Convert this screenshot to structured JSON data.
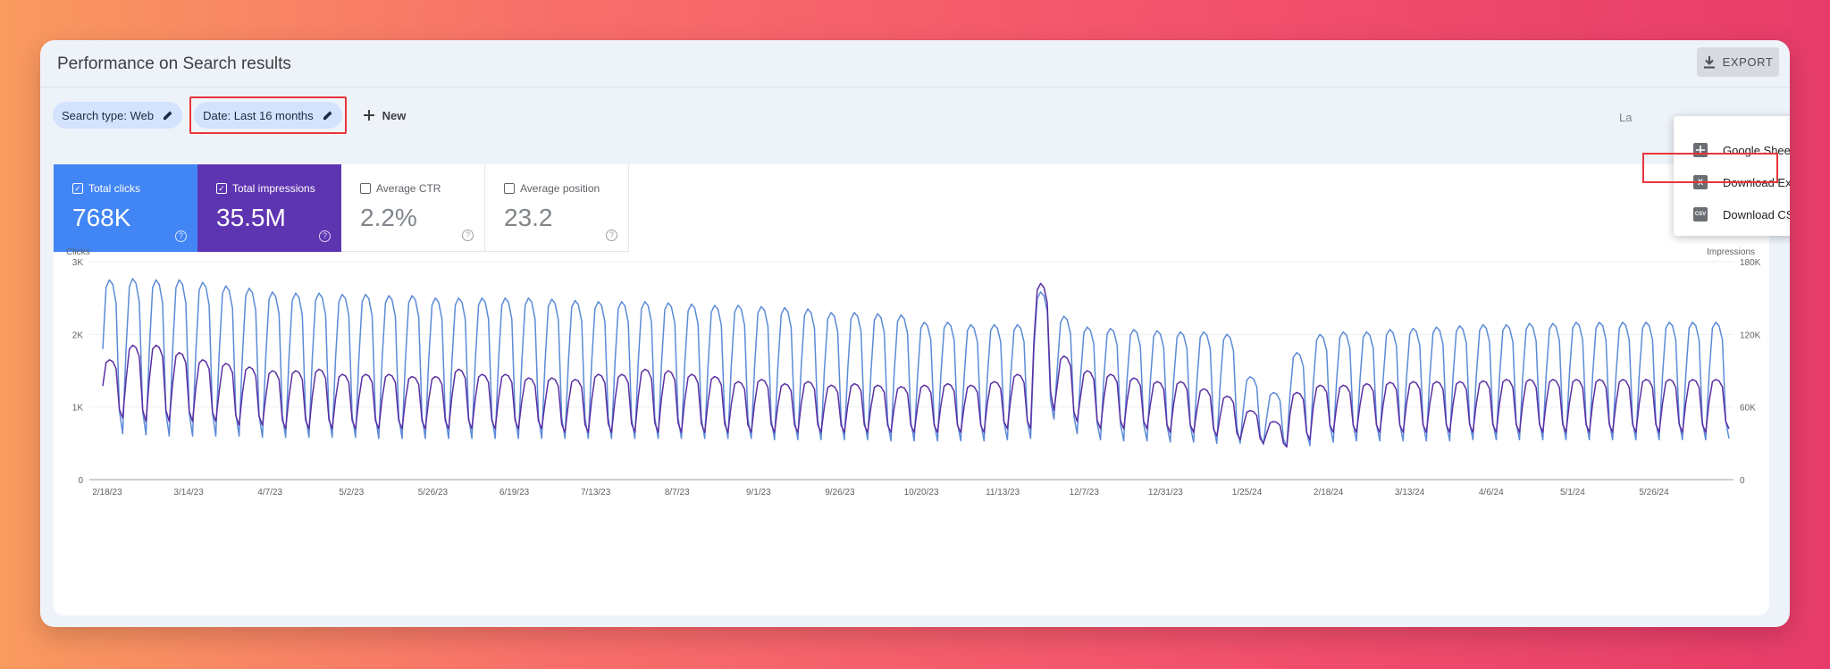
{
  "header": {
    "title": "Performance on Search results",
    "export_label": "EXPORT"
  },
  "filters": {
    "search_type": "Search type: Web",
    "date": "Date: Last 16 months",
    "new_label": "New",
    "partial_label": "La"
  },
  "export_menu": {
    "items": [
      {
        "label": "Google Sheets",
        "icon": "google-sheets-icon"
      },
      {
        "label": "Download Excel",
        "icon": "excel-icon",
        "glyph": "X"
      },
      {
        "label": "Download CSV",
        "icon": "csv-icon",
        "glyph": "CSV"
      }
    ]
  },
  "metrics": [
    {
      "label": "Total clicks",
      "value": "768K",
      "checked": true,
      "color": "#4285f4"
    },
    {
      "label": "Total impressions",
      "value": "35.5M",
      "checked": true,
      "color": "#5e35b1"
    },
    {
      "label": "Average CTR",
      "value": "2.2%",
      "checked": false
    },
    {
      "label": "Average position",
      "value": "23.2",
      "checked": false
    }
  ],
  "chart_data": {
    "type": "line",
    "left_axis": {
      "label": "Clicks",
      "ticks": [
        "0",
        "1K",
        "2K",
        "3K"
      ],
      "range": [
        0,
        3000
      ]
    },
    "right_axis": {
      "label": "Impressions",
      "ticks": [
        "0",
        "60K",
        "120K",
        "180K"
      ],
      "range": [
        0,
        180000
      ]
    },
    "x_tick_labels": [
      "2/18/23",
      "3/14/23",
      "4/7/23",
      "5/2/23",
      "5/26/23",
      "6/19/23",
      "7/13/23",
      "8/7/23",
      "9/1/23",
      "9/26/23",
      "10/20/23",
      "11/13/23",
      "12/7/23",
      "12/31/23",
      "1/25/24",
      "2/18/24",
      "3/13/24",
      "4/6/24",
      "5/1/24",
      "5/26/24"
    ],
    "series": [
      {
        "name": "Clicks",
        "axis": "left",
        "color": "#5a2fa3",
        "weekly_peak": [
          1650,
          1850,
          1850,
          1750,
          1650,
          1600,
          1550,
          1500,
          1500,
          1520,
          1450,
          1450,
          1450,
          1420,
          1420,
          1520,
          1450,
          1450,
          1400,
          1400,
          1380,
          1450,
          1450,
          1520,
          1500,
          1450,
          1420,
          1350,
          1380,
          1320,
          1350,
          1300,
          1320,
          1300,
          1280,
          1300,
          1320,
          1300,
          1350,
          1450,
          2700,
          1700,
          1500,
          1450,
          1400,
          1350,
          1350,
          1250,
          1150,
          950,
          800,
          1200,
          1300,
          1300,
          1320,
          1340,
          1350,
          1350,
          1350,
          1360,
          1380,
          1380,
          1380,
          1380,
          1380,
          1380,
          1380,
          1380,
          1380,
          1380
        ],
        "weekly_trough": [
          850,
          800,
          800,
          800,
          800,
          750,
          750,
          700,
          700,
          700,
          700,
          700,
          700,
          700,
          700,
          700,
          700,
          700,
          700,
          650,
          650,
          650,
          650,
          650,
          650,
          650,
          650,
          650,
          650,
          650,
          650,
          650,
          650,
          650,
          650,
          650,
          650,
          650,
          700,
          700,
          950,
          800,
          700,
          700,
          700,
          650,
          650,
          600,
          550,
          500,
          450,
          550,
          650,
          650,
          650,
          650,
          650,
          650,
          650,
          650,
          650,
          650,
          650,
          650,
          650,
          650,
          650,
          650,
          650,
          700
        ]
      },
      {
        "name": "Impressions",
        "axis": "right",
        "color": "#5b8bd6",
        "weekly_peak": [
          165000,
          166000,
          165000,
          165000,
          163000,
          160000,
          158000,
          155000,
          154000,
          154000,
          153000,
          153000,
          152000,
          152000,
          150000,
          150000,
          150000,
          150000,
          150000,
          149000,
          148000,
          147000,
          147000,
          147000,
          146000,
          145000,
          144000,
          144000,
          143000,
          142000,
          141000,
          138000,
          138000,
          137000,
          136000,
          130000,
          130000,
          128000,
          128000,
          128000,
          155000,
          135000,
          126000,
          125000,
          124000,
          123000,
          122000,
          122000,
          120000,
          85000,
          72000,
          105000,
          120000,
          122000,
          122000,
          124000,
          125000,
          126000,
          127000,
          128000,
          128000,
          129000,
          129000,
          130000,
          130000,
          130000,
          130000,
          130000,
          130000,
          130000
        ],
        "weekly_trough": [
          38000,
          37000,
          36000,
          36000,
          36000,
          36000,
          35000,
          35000,
          35000,
          35000,
          35000,
          34000,
          34000,
          34000,
          34000,
          34000,
          34000,
          34000,
          34000,
          34000,
          34000,
          34000,
          34000,
          34000,
          34000,
          34000,
          34000,
          34000,
          33000,
          33000,
          33000,
          33000,
          33000,
          32000,
          32000,
          32000,
          32000,
          32000,
          33000,
          34000,
          50000,
          38000,
          33000,
          32000,
          32000,
          31000,
          31000,
          30000,
          30000,
          29000,
          27000,
          28000,
          31000,
          32000,
          32000,
          32000,
          32000,
          32000,
          33000,
          33000,
          33000,
          33000,
          33000,
          33000,
          33000,
          33000,
          33000,
          33000,
          33000,
          34000
        ]
      }
    ]
  }
}
